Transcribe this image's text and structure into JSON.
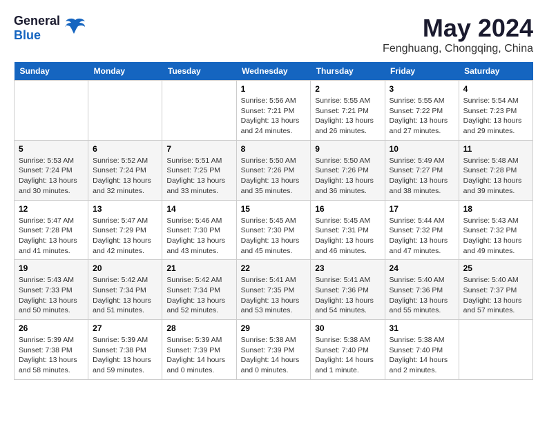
{
  "logo": {
    "general": "General",
    "blue": "Blue"
  },
  "title": "May 2024",
  "location": "Fenghuang, Chongqing, China",
  "days_header": [
    "Sunday",
    "Monday",
    "Tuesday",
    "Wednesday",
    "Thursday",
    "Friday",
    "Saturday"
  ],
  "weeks": [
    [
      {
        "day": "",
        "info": ""
      },
      {
        "day": "",
        "info": ""
      },
      {
        "day": "",
        "info": ""
      },
      {
        "day": "1",
        "info": "Sunrise: 5:56 AM\nSunset: 7:21 PM\nDaylight: 13 hours\nand 24 minutes."
      },
      {
        "day": "2",
        "info": "Sunrise: 5:55 AM\nSunset: 7:21 PM\nDaylight: 13 hours\nand 26 minutes."
      },
      {
        "day": "3",
        "info": "Sunrise: 5:55 AM\nSunset: 7:22 PM\nDaylight: 13 hours\nand 27 minutes."
      },
      {
        "day": "4",
        "info": "Sunrise: 5:54 AM\nSunset: 7:23 PM\nDaylight: 13 hours\nand 29 minutes."
      }
    ],
    [
      {
        "day": "5",
        "info": "Sunrise: 5:53 AM\nSunset: 7:24 PM\nDaylight: 13 hours\nand 30 minutes."
      },
      {
        "day": "6",
        "info": "Sunrise: 5:52 AM\nSunset: 7:24 PM\nDaylight: 13 hours\nand 32 minutes."
      },
      {
        "day": "7",
        "info": "Sunrise: 5:51 AM\nSunset: 7:25 PM\nDaylight: 13 hours\nand 33 minutes."
      },
      {
        "day": "8",
        "info": "Sunrise: 5:50 AM\nSunset: 7:26 PM\nDaylight: 13 hours\nand 35 minutes."
      },
      {
        "day": "9",
        "info": "Sunrise: 5:50 AM\nSunset: 7:26 PM\nDaylight: 13 hours\nand 36 minutes."
      },
      {
        "day": "10",
        "info": "Sunrise: 5:49 AM\nSunset: 7:27 PM\nDaylight: 13 hours\nand 38 minutes."
      },
      {
        "day": "11",
        "info": "Sunrise: 5:48 AM\nSunset: 7:28 PM\nDaylight: 13 hours\nand 39 minutes."
      }
    ],
    [
      {
        "day": "12",
        "info": "Sunrise: 5:47 AM\nSunset: 7:28 PM\nDaylight: 13 hours\nand 41 minutes."
      },
      {
        "day": "13",
        "info": "Sunrise: 5:47 AM\nSunset: 7:29 PM\nDaylight: 13 hours\nand 42 minutes."
      },
      {
        "day": "14",
        "info": "Sunrise: 5:46 AM\nSunset: 7:30 PM\nDaylight: 13 hours\nand 43 minutes."
      },
      {
        "day": "15",
        "info": "Sunrise: 5:45 AM\nSunset: 7:30 PM\nDaylight: 13 hours\nand 45 minutes."
      },
      {
        "day": "16",
        "info": "Sunrise: 5:45 AM\nSunset: 7:31 PM\nDaylight: 13 hours\nand 46 minutes."
      },
      {
        "day": "17",
        "info": "Sunrise: 5:44 AM\nSunset: 7:32 PM\nDaylight: 13 hours\nand 47 minutes."
      },
      {
        "day": "18",
        "info": "Sunrise: 5:43 AM\nSunset: 7:32 PM\nDaylight: 13 hours\nand 49 minutes."
      }
    ],
    [
      {
        "day": "19",
        "info": "Sunrise: 5:43 AM\nSunset: 7:33 PM\nDaylight: 13 hours\nand 50 minutes."
      },
      {
        "day": "20",
        "info": "Sunrise: 5:42 AM\nSunset: 7:34 PM\nDaylight: 13 hours\nand 51 minutes."
      },
      {
        "day": "21",
        "info": "Sunrise: 5:42 AM\nSunset: 7:34 PM\nDaylight: 13 hours\nand 52 minutes."
      },
      {
        "day": "22",
        "info": "Sunrise: 5:41 AM\nSunset: 7:35 PM\nDaylight: 13 hours\nand 53 minutes."
      },
      {
        "day": "23",
        "info": "Sunrise: 5:41 AM\nSunset: 7:36 PM\nDaylight: 13 hours\nand 54 minutes."
      },
      {
        "day": "24",
        "info": "Sunrise: 5:40 AM\nSunset: 7:36 PM\nDaylight: 13 hours\nand 55 minutes."
      },
      {
        "day": "25",
        "info": "Sunrise: 5:40 AM\nSunset: 7:37 PM\nDaylight: 13 hours\nand 57 minutes."
      }
    ],
    [
      {
        "day": "26",
        "info": "Sunrise: 5:39 AM\nSunset: 7:38 PM\nDaylight: 13 hours\nand 58 minutes."
      },
      {
        "day": "27",
        "info": "Sunrise: 5:39 AM\nSunset: 7:38 PM\nDaylight: 13 hours\nand 59 minutes."
      },
      {
        "day": "28",
        "info": "Sunrise: 5:39 AM\nSunset: 7:39 PM\nDaylight: 14 hours\nand 0 minutes."
      },
      {
        "day": "29",
        "info": "Sunrise: 5:38 AM\nSunset: 7:39 PM\nDaylight: 14 hours\nand 0 minutes."
      },
      {
        "day": "30",
        "info": "Sunrise: 5:38 AM\nSunset: 7:40 PM\nDaylight: 14 hours\nand 1 minute."
      },
      {
        "day": "31",
        "info": "Sunrise: 5:38 AM\nSunset: 7:40 PM\nDaylight: 14 hours\nand 2 minutes."
      },
      {
        "day": "",
        "info": ""
      }
    ]
  ]
}
